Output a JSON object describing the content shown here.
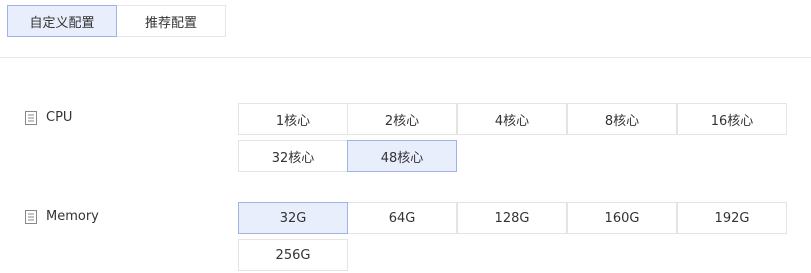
{
  "tabs": [
    {
      "label": "自定义配置",
      "active": true
    },
    {
      "label": "推荐配置",
      "active": false
    }
  ],
  "cpu": {
    "label": "CPU",
    "icon": "document-list-icon",
    "options": [
      "1核心",
      "2核心",
      "4核心",
      "8核心",
      "16核心",
      "32核心",
      "48核心"
    ],
    "selected": "48核心"
  },
  "memory": {
    "label": "Memory",
    "icon": "document-list-icon",
    "options": [
      "32G",
      "64G",
      "128G",
      "160G",
      "192G",
      "256G"
    ],
    "selected": "32G"
  },
  "colors": {
    "selected_bg": "#e8eefc",
    "selected_border": "#9fb3e8",
    "border": "#e4e4e4"
  }
}
